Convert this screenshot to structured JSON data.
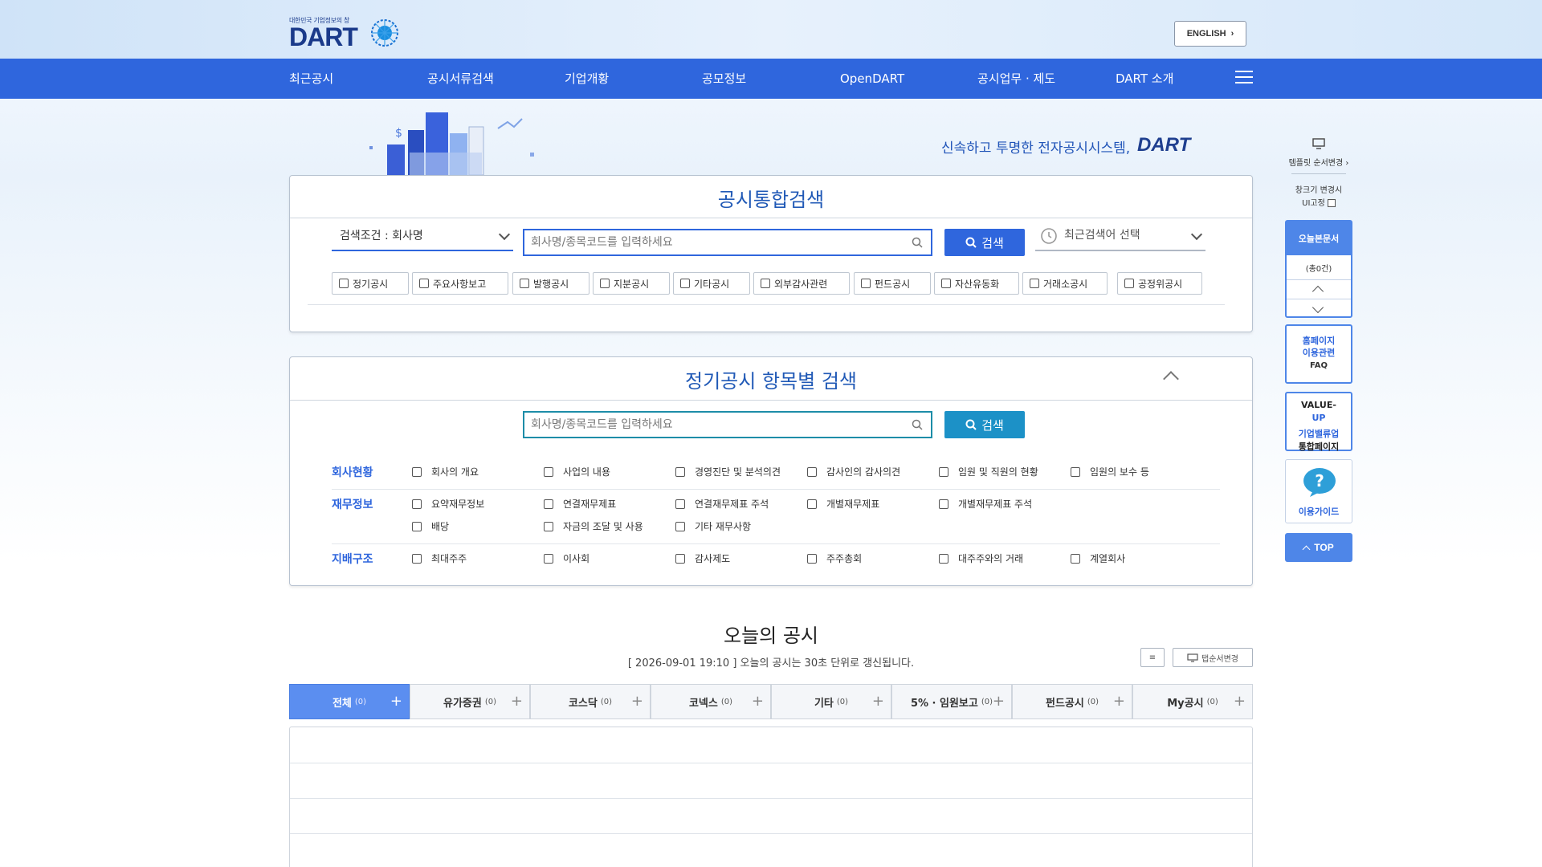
{
  "header": {
    "logo_sub": "대한민국 기업정보의 창",
    "logo_main": "DART",
    "english_label": "ENGLISH"
  },
  "nav": {
    "items": [
      "최근공시",
      "공시서류검색",
      "기업개황",
      "공모정보",
      "OpenDART",
      "공시업무 · 제도",
      "DART 소개"
    ]
  },
  "hero": {
    "tagline": "신속하고 투명한 전자공시시스템,",
    "tagline_brand": "DART"
  },
  "integrated_search": {
    "title": "공시통합검색",
    "condition_label": "검색조건 : 회사명",
    "input_placeholder": "회사명/종목코드를 입력하세요",
    "search_label": "검색",
    "recent_label": "최근검색어 선택",
    "filters": [
      "정기공시",
      "주요사항보고",
      "발행공시",
      "지분공시",
      "기타공시",
      "외부감사관련",
      "펀드공시",
      "자산유동화",
      "거래소공시",
      "공정위공시"
    ]
  },
  "periodic_search": {
    "title": "정기공시 항목별 검색",
    "input_placeholder": "회사명/종목코드를 입력하세요",
    "search_label": "검색",
    "categories": [
      {
        "label": "회사현황",
        "items": [
          "회사의 개요",
          "사업의 내용",
          "경영진단 및 분석의견",
          "감사인의 감사의견",
          "임원 및 직원의 현황",
          "임원의 보수 등"
        ]
      },
      {
        "label": "재무정보",
        "items": [
          "요약재무정보",
          "연결재무제표",
          "연결재무제표 주석",
          "개별재무제표",
          "개별재무제표 주석",
          "배당",
          "자금의 조달 및 사용",
          "기타 재무사항"
        ]
      },
      {
        "label": "지배구조",
        "items": [
          "최대주주",
          "이사회",
          "감사제도",
          "주주총회",
          "대주주와의 거래",
          "계열회사"
        ]
      }
    ]
  },
  "today": {
    "title": "오늘의 공시",
    "subtitle": "[ 2026-09-01 19:10 ] 오늘의 공시는 30초 단위로 갱신됩니다.",
    "list_btn": "≡",
    "tab_order_btn": "탭순서변경",
    "tabs": [
      {
        "label": "전체",
        "count": "(0)"
      },
      {
        "label": "유가증권",
        "count": "(0)"
      },
      {
        "label": "코스닥",
        "count": "(0)"
      },
      {
        "label": "코넥스",
        "count": "(0)"
      },
      {
        "label": "기타",
        "count": "(0)"
      },
      {
        "label": "5% · 임원보고",
        "count": "(0)"
      },
      {
        "label": "펀드공시",
        "count": "(0)"
      },
      {
        "label": "My공시",
        "count": "(0)"
      }
    ]
  },
  "sidebar": {
    "template_label": "템플릿 순서변경",
    "window_fix_line1": "창크기 변경시",
    "window_fix_line2": "UI고정",
    "viewed_title": "오늘본문서",
    "viewed_count": "(총0건)",
    "faq_line1": "홈페이지",
    "faq_line2": "이용관련",
    "faq_line3": "FAQ",
    "valueup_line1": "VALUE-",
    "valueup_line2": "UP",
    "valueup_line3": "기업밸류업",
    "valueup_line4": "통합페이지",
    "guide_label": "이용가이드",
    "top_label": "TOP"
  }
}
